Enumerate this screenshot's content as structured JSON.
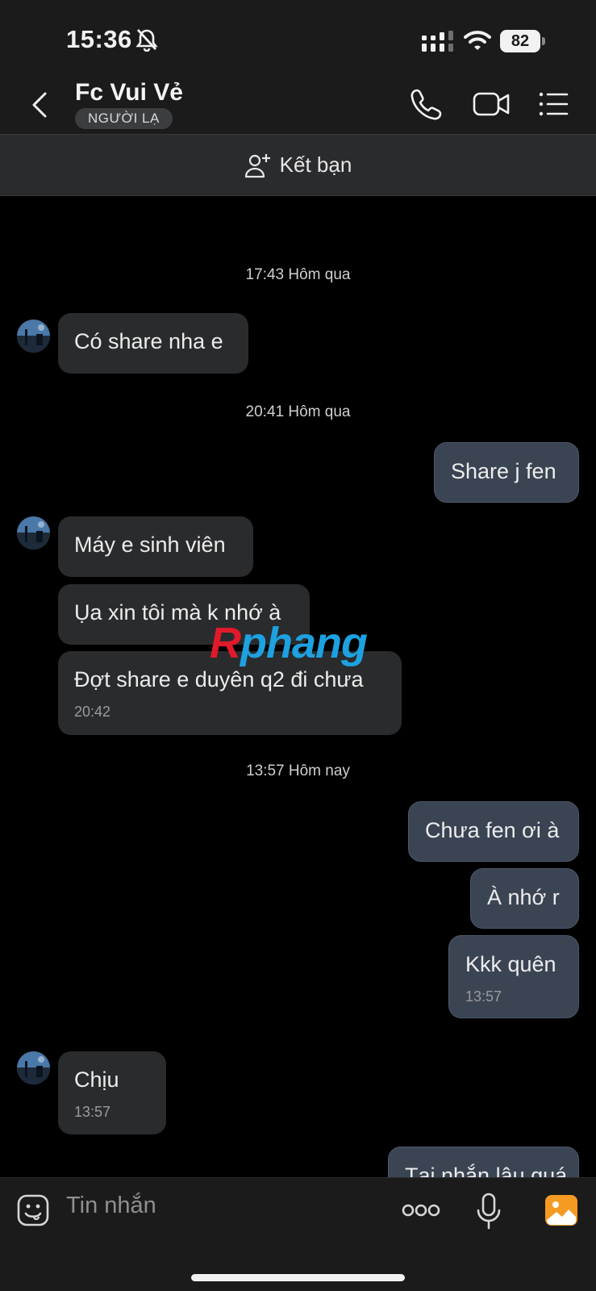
{
  "status_bar": {
    "time": "15:36",
    "battery": "82"
  },
  "header": {
    "title": "Fc Vui Vẻ",
    "badge": "NGƯỜI LẠ"
  },
  "friend_bar": {
    "label": "Kết bạn"
  },
  "timestamps": [
    "17:43 Hôm qua",
    "20:41 Hôm qua",
    "13:57 Hôm nay"
  ],
  "messages": [
    {
      "side": "in",
      "text": "Có share nha e"
    },
    {
      "side": "out",
      "text": "Share j fen"
    },
    {
      "side": "in",
      "text": "Máy e sinh viên"
    },
    {
      "side": "in",
      "text": "Ụa xin tôi mà k nhớ à"
    },
    {
      "side": "in",
      "text": "Đợt share e duyên q2 đi chưa",
      "time": "20:42"
    },
    {
      "side": "out",
      "text": "Chưa fen ơi à"
    },
    {
      "side": "out",
      "text": "À nhớ r"
    },
    {
      "side": "out",
      "text": "Kkk quên",
      "time": "13:57"
    },
    {
      "side": "in",
      "text": "Chịu",
      "time": "13:57"
    },
    {
      "side": "out",
      "text": "Tại nhắn lâu quá"
    }
  ],
  "watermark": {
    "part1": "R",
    "part2": "phang"
  },
  "composer": {
    "placeholder": "Tin nhắn"
  },
  "colors": {
    "incoming_bubble": "#2a2b2d",
    "outgoing_bubble": "#3a4453",
    "background": "#000000",
    "header": "#1b1b1c",
    "photo_icon": "#f59a23"
  }
}
